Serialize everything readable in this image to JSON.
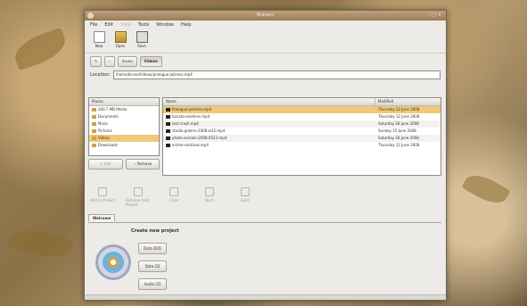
{
  "window": {
    "title": "Brasero"
  },
  "menubar": {
    "items": [
      "File",
      "Edit",
      "View",
      "Tools",
      "Window",
      "Help"
    ]
  },
  "toolbar": {
    "new": "New",
    "open": "Open",
    "save": "Save"
  },
  "pathbar": {
    "segments": [
      "bruno",
      "Videos"
    ]
  },
  "location": {
    "label": "Location:",
    "value": "/home/bruno/Videos/prologue-joliness.mp4"
  },
  "places": {
    "header": "Places",
    "items": [
      "200.7 MB Media",
      "Documents",
      "Music",
      "Pictures",
      "Videos",
      "Downloads"
    ],
    "add": "Add",
    "remove": "Remove"
  },
  "files": {
    "col_name": "Name",
    "col_modified": "Modified",
    "rows": [
      {
        "name": "Prologue-joliness.mp4",
        "modified": "Thursday 12 June 2008"
      },
      {
        "name": "kanata-sardines.mp4",
        "modified": "Thursday 12 June 2008"
      },
      {
        "name": "last-crash.mp4",
        "modified": "Saturday 28 June 2008"
      },
      {
        "name": "studio-galerie-2008-w32.mp4",
        "modified": "Sunday 15 June 2008"
      },
      {
        "name": "photo-session-2008-0523.mp4",
        "modified": "Saturday 28 June 2008"
      },
      {
        "name": "anime-sardinas.mp4",
        "modified": "Thursday 12 June 2008"
      }
    ]
  },
  "actions": [
    "Add to Project",
    "Remove from Project",
    "Clear",
    "Burn",
    "Eject"
  ],
  "tabs": {
    "welcome": "Welcome"
  },
  "welcome": {
    "heading": "Create new project",
    "data_dvd": "Data DVD",
    "data_cd": "Data CD",
    "audio_cd": "Audio CD"
  }
}
